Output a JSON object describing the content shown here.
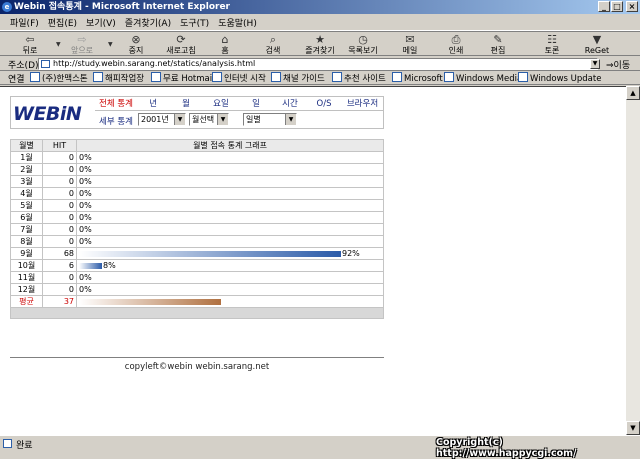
{
  "window": {
    "title": "Webin 접속통계 - Microsoft Internet Explorer",
    "min": "_",
    "max": "□",
    "close": "×"
  },
  "menu": [
    "파일(F)",
    "편집(E)",
    "보기(V)",
    "즐겨찾기(A)",
    "도구(T)",
    "도움말(H)"
  ],
  "toolbar": {
    "back": "뒤로",
    "forward": "앞으로",
    "stop": "중지",
    "refresh": "새로고침",
    "home": "홈",
    "search": "검색",
    "favorites": "즐겨찾기",
    "history": "목록보기",
    "mail": "메일",
    "print": "인쇄",
    "edit": "편집",
    "discuss": "토론",
    "reget": "ReGet"
  },
  "address": {
    "label": "주소(D)",
    "url": "http://study.webin.sarang.net/statics/analysis.html",
    "go": "이동"
  },
  "links": {
    "label": "연결",
    "items": [
      "(주)한맥스톤",
      "해피작업장",
      "무료 Hotmail",
      "인터넷 시작",
      "채널 가이드",
      "추천 사이트",
      "Microsoft",
      "Windows Media",
      "Windows Update"
    ]
  },
  "page": {
    "logo": "WEBiN",
    "nav": [
      "전체 통계",
      "년",
      "월",
      "요일",
      "일",
      "시간",
      "O/S",
      "브라우저"
    ],
    "detail_label": "세부 통계",
    "selects": {
      "year": "2001년",
      "month": "월선택",
      "day": "일별"
    },
    "table": {
      "headers": [
        "월별",
        "HIT",
        "월별 접속 통계 그래프"
      ],
      "rows": [
        {
          "month": "1월",
          "hit": "0",
          "pct": "0%",
          "value": 0
        },
        {
          "month": "2월",
          "hit": "0",
          "pct": "0%",
          "value": 0
        },
        {
          "month": "3월",
          "hit": "0",
          "pct": "0%",
          "value": 0
        },
        {
          "month": "4월",
          "hit": "0",
          "pct": "0%",
          "value": 0
        },
        {
          "month": "5월",
          "hit": "0",
          "pct": "0%",
          "value": 0
        },
        {
          "month": "6월",
          "hit": "0",
          "pct": "0%",
          "value": 0
        },
        {
          "month": "7월",
          "hit": "0",
          "pct": "0%",
          "value": 0
        },
        {
          "month": "8월",
          "hit": "0",
          "pct": "0%",
          "value": 0
        },
        {
          "month": "9월",
          "hit": "68",
          "pct": "92%",
          "value": 92
        },
        {
          "month": "10월",
          "hit": "6",
          "pct": "8%",
          "value": 8
        },
        {
          "month": "11월",
          "hit": "0",
          "pct": "0%",
          "value": 0
        },
        {
          "month": "12월",
          "hit": "0",
          "pct": "0%",
          "value": 0
        }
      ],
      "average": {
        "month": "평균",
        "hit": "37",
        "value": 50
      }
    },
    "footer": "copyleft©webin webin.sarang.net"
  },
  "status": {
    "text": "완료",
    "copyright": "Copyright(c) http://www.happycgi.com/"
  },
  "colors": {
    "bar": "#2a5aa8",
    "avg_bar": "#b07040",
    "accent": "#1a2c80",
    "red": "#cc0000"
  }
}
